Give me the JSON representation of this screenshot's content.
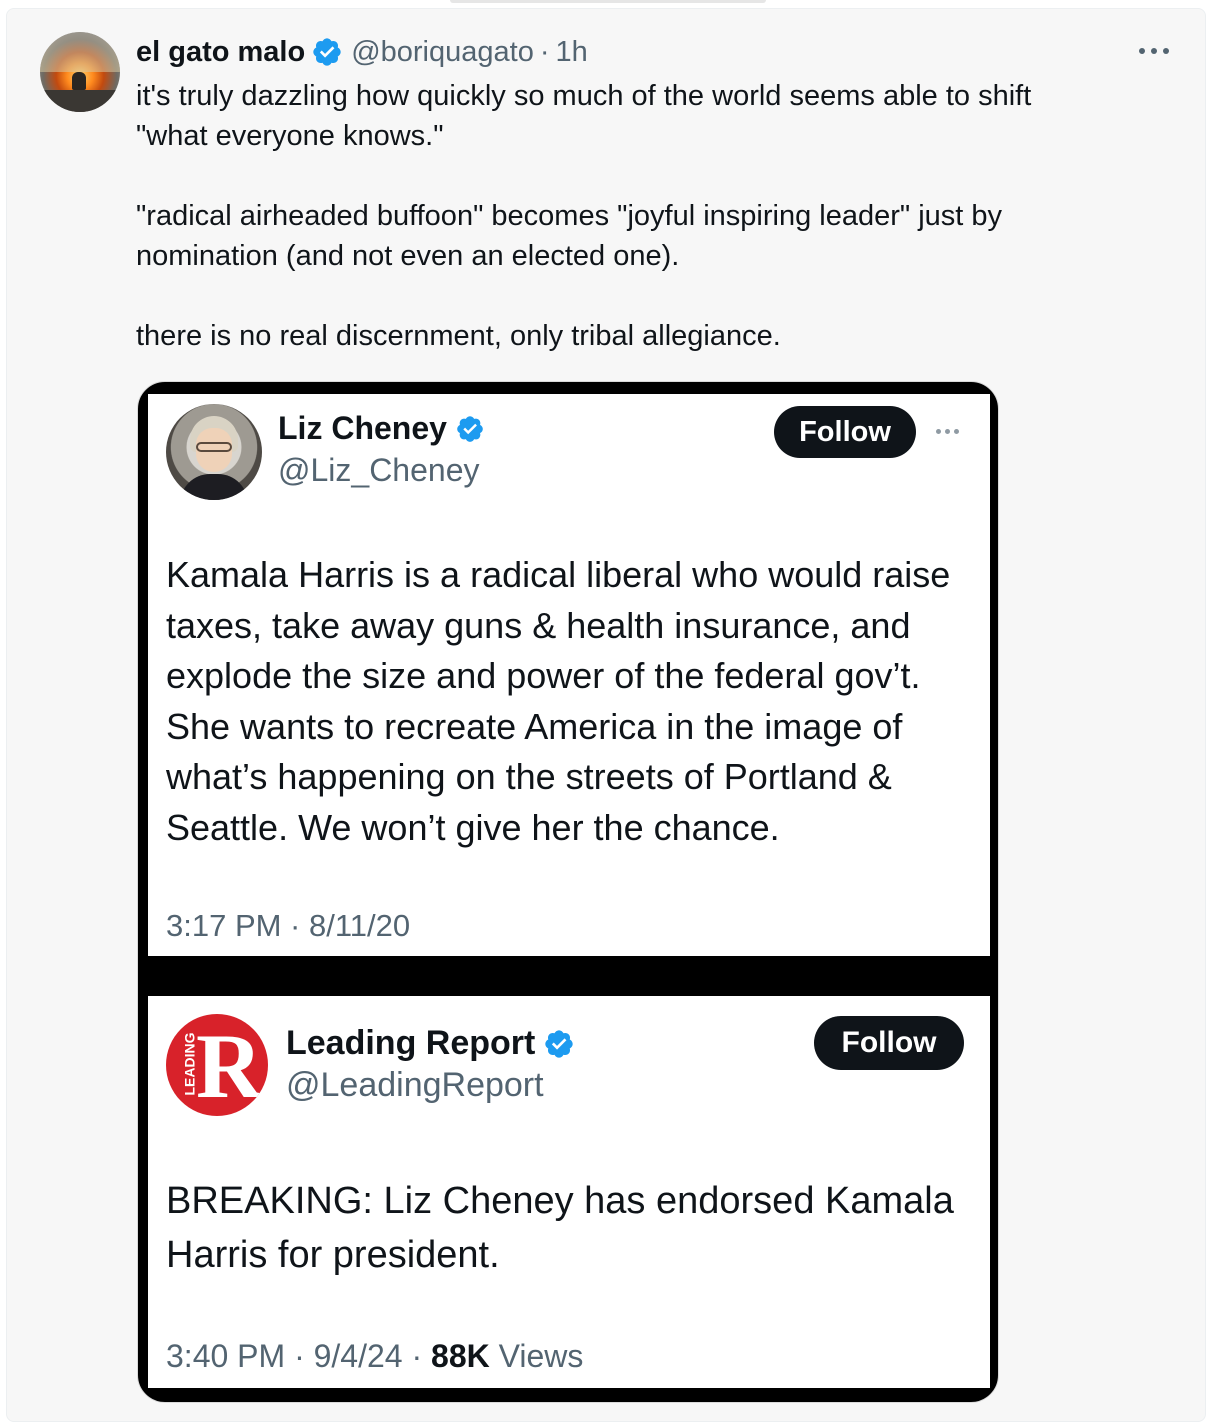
{
  "tweet": {
    "display_name": "el gato malo",
    "handle": "@boriquagato",
    "separator": "·",
    "time": "1h",
    "text_lines": [
      "it's truly dazzling how quickly so much of the world seems able to shift",
      "\"what everyone knows.\"",
      "",
      "\"radical airheaded buffoon\" becomes \"joyful inspiring leader\" just by",
      "nomination (and not even an elected one).",
      "",
      "there is no real discernment, only tribal allegiance."
    ],
    "avatar_icon": "avatar-image",
    "more_icon": "more-horizontal-icon"
  },
  "screenshot_1": {
    "display_name": "Liz Cheney",
    "handle": "@Liz_Cheney",
    "follow_label": "Follow",
    "body_lines": [
      "Kamala Harris is a radical liberal who would raise",
      "taxes, take away guns & health insurance, and",
      "explode the size and power of the federal gov’t.",
      "She wants to recreate America in the image of",
      "what’s happening on the streets of Portland &",
      "Seattle. We won’t give her the chance."
    ],
    "timestamp": "3:17 PM · 8/11/20"
  },
  "screenshot_2": {
    "display_name": "Leading Report",
    "handle": "@LeadingReport",
    "follow_label": "Follow",
    "avatar_letter": "R",
    "avatar_word": "LEADING",
    "body_lines": [
      "BREAKING: Liz Cheney has endorsed Kamala",
      "Harris for president."
    ],
    "timestamp": "3:40 PM · 9/4/24 · ",
    "views_count": "88K",
    "views_label": " Views"
  },
  "colors": {
    "verified_blue": "#1d9bf0",
    "text_primary": "#0f1419",
    "text_secondary": "#536471",
    "leading_report_red": "#d8222a"
  }
}
